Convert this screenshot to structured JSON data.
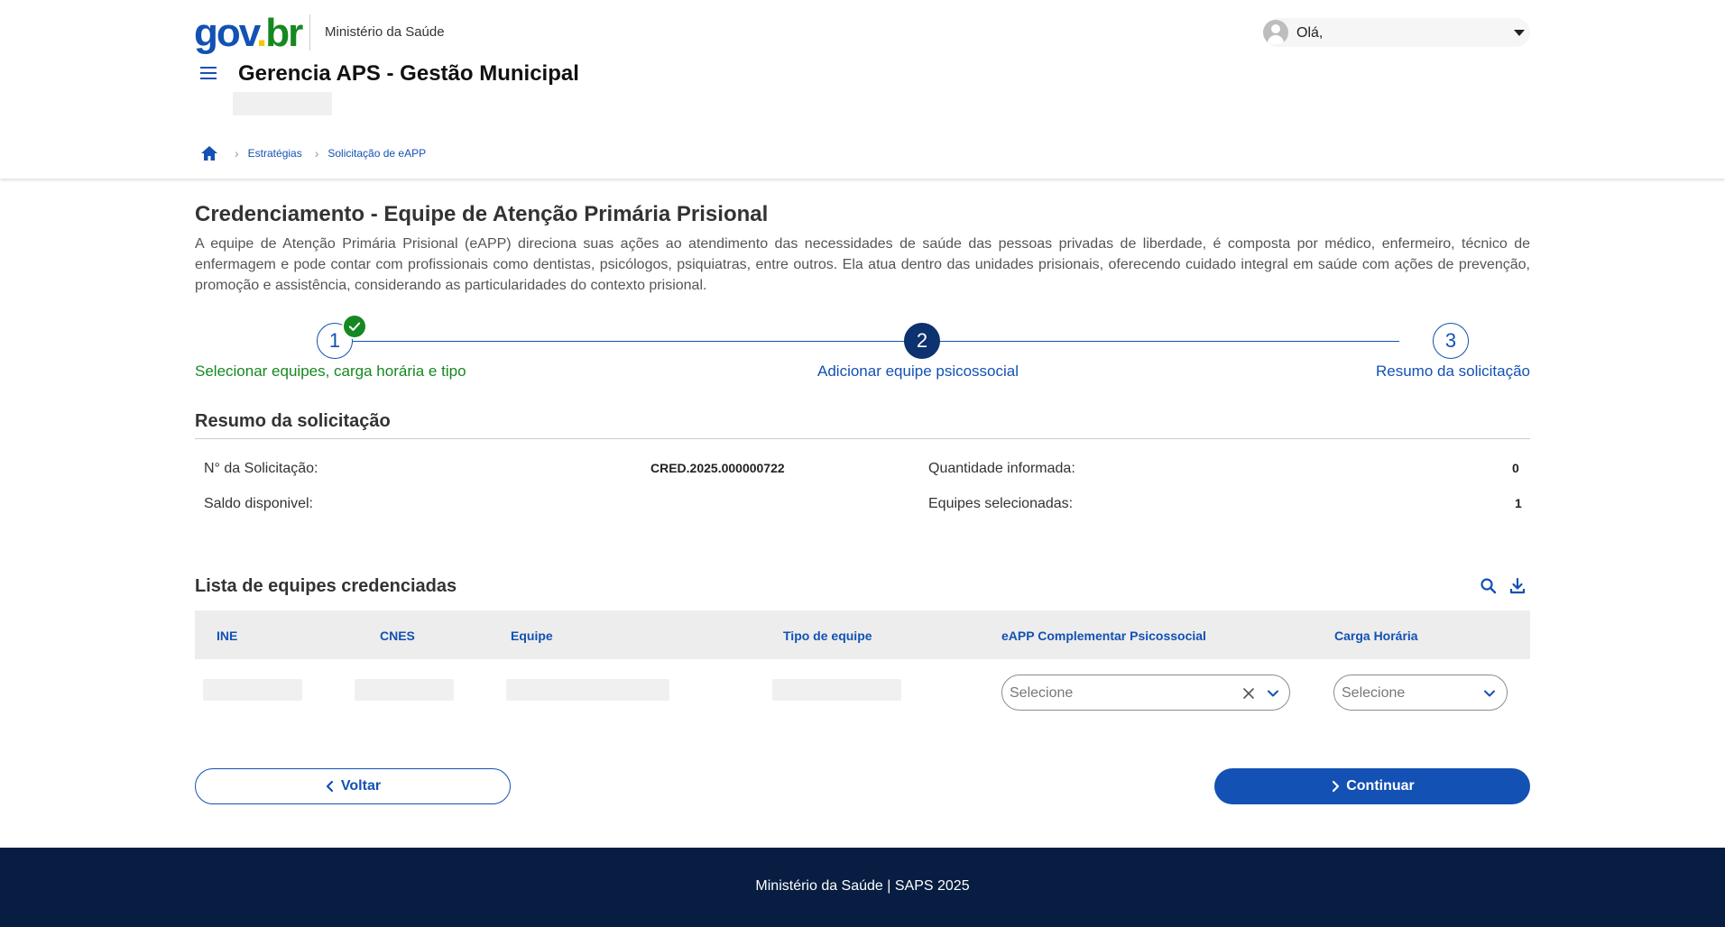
{
  "header": {
    "logo": {
      "part1": "gov",
      "dot": ".",
      "part2": "br"
    },
    "org_name": "Ministério da Saúde",
    "app_title": "Gerencia APS - Gestão Municipal",
    "user_greeting": "Olá,"
  },
  "breadcrumb": {
    "items": [
      {
        "label": "Estratégias"
      },
      {
        "label": "Solicitação de eAPP"
      }
    ]
  },
  "page": {
    "title": "Credenciamento - Equipe de Atenção Primária Prisional",
    "description": "A equipe de Atenção Primária Prisional (eAPP) direciona suas ações ao atendimento das necessidades de saúde das pessoas privadas de liberdade, é composta por médico, enfermeiro, técnico de enfermagem e pode contar com profissionais como dentistas, psicólogos, psiquiatras, entre outros. Ela atua dentro das unidades prisionais, oferecendo cuidado integral em saúde com ações de prevenção, promoção e assistência, considerando as particularidades do contexto prisional."
  },
  "stepper": {
    "steps": [
      {
        "number": "1",
        "label": "Selecionar equipes, carga horária e tipo",
        "state": "done"
      },
      {
        "number": "2",
        "label": "Adicionar equipe psicossocial",
        "state": "current"
      },
      {
        "number": "3",
        "label": "Resumo da solicitação",
        "state": "pending"
      }
    ]
  },
  "summary": {
    "title": "Resumo da solicitação",
    "request_number_label": "N° da Solicitação:",
    "request_number_value": "CRED.2025.000000722",
    "quantity_label": "Quantidade informada:",
    "quantity_value": "0",
    "balance_label": "Saldo disponivel:",
    "selected_label": "Equipes selecionadas:",
    "selected_value": "1"
  },
  "table": {
    "title": "Lista de equipes credenciadas",
    "columns": [
      "INE",
      "CNES",
      "Equipe",
      "Tipo de equipe",
      "eAPP Complementar Psicossocial",
      "Carga Horária"
    ],
    "rows": [
      {
        "psicossocial_placeholder": "Selecione",
        "carga_placeholder": "Selecione"
      }
    ]
  },
  "actions": {
    "back_label": "Voltar",
    "continue_label": "Continuar"
  },
  "footer": {
    "text": "Ministério da Saúde | SAPS 2025"
  },
  "colors": {
    "primary": "#1351b4",
    "dark_blue": "#0c326f",
    "success": "#168821",
    "footer_bg": "#071d41"
  },
  "icons": [
    "menu-icon",
    "home-icon",
    "chevron-right-icon",
    "check-icon",
    "search-icon",
    "download-icon",
    "close-icon",
    "chevron-down-icon",
    "chevron-left-icon",
    "user-avatar-icon"
  ]
}
